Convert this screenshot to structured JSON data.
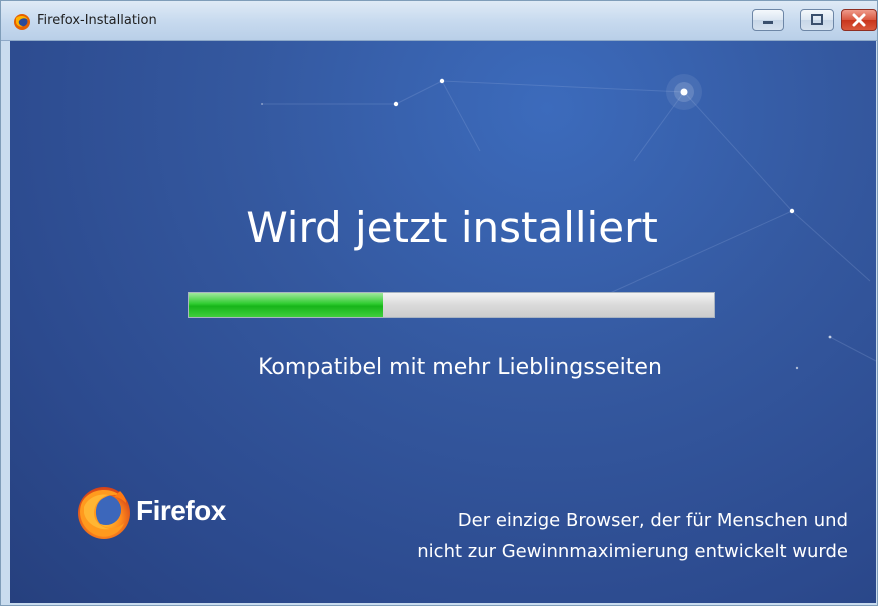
{
  "window": {
    "title": "Firefox-Installation",
    "icons": {
      "app": "firefox-icon",
      "minimize": "minimize-icon",
      "maximize": "maximize-icon",
      "close": "close-icon"
    },
    "close_color": "#c8351c"
  },
  "installer": {
    "headline": "Wird jetzt installiert",
    "progress_fraction": 0.37,
    "progress_color": "#2fcc30",
    "tagline": "Kompatibel mit mehr Lieblingsseiten",
    "brand": "Firefox",
    "slogan_line1": "Der einzige Browser, der für Menschen und",
    "slogan_line2": "nicht zur Gewinnmaximierung entwickelt wurde",
    "background_color": "#34589f"
  }
}
